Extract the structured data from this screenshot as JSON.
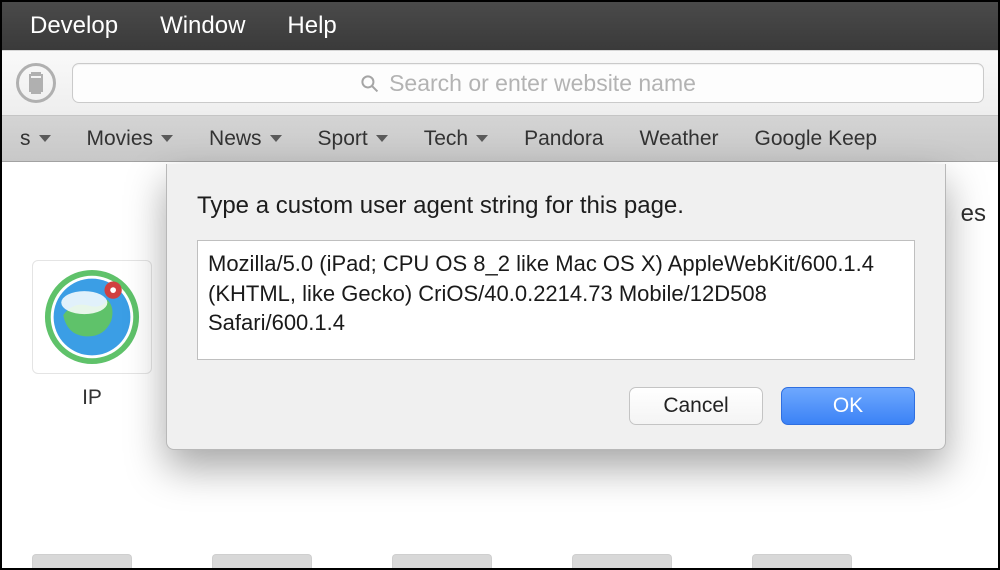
{
  "menubar": {
    "items": [
      "Develop",
      "Window",
      "Help"
    ]
  },
  "toolbar": {
    "url_placeholder": "Search or enter website name"
  },
  "bookmarks": {
    "items": [
      {
        "label": "s",
        "dropdown": true
      },
      {
        "label": "Movies",
        "dropdown": true
      },
      {
        "label": "News",
        "dropdown": true
      },
      {
        "label": "Sport",
        "dropdown": true
      },
      {
        "label": "Tech",
        "dropdown": true
      },
      {
        "label": "Pandora",
        "dropdown": false
      },
      {
        "label": "Weather",
        "dropdown": false
      },
      {
        "label": "Google Keep",
        "dropdown": false
      }
    ]
  },
  "favorites": {
    "item_label": "IP",
    "cut_text": "es"
  },
  "dialog": {
    "title": "Type a custom user agent string for this page.",
    "ua_value": "Mozilla/5.0 (iPad; CPU OS 8_2 like Mac OS X) AppleWebKit/600.1.4 (KHTML, like Gecko) CriOS/40.0.2214.73 Mobile/12D508 Safari/600.1.4",
    "cancel_label": "Cancel",
    "ok_label": "OK"
  }
}
